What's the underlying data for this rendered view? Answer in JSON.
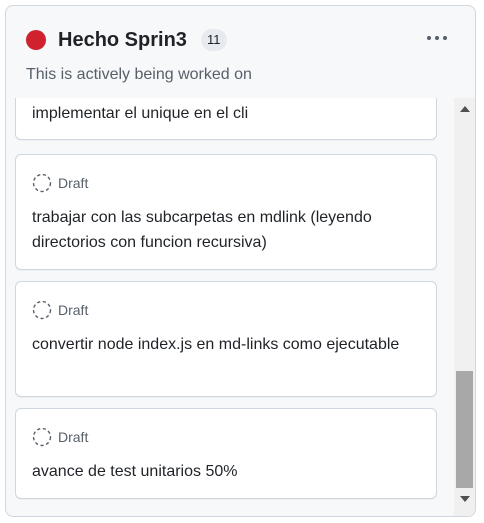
{
  "column": {
    "title": "Hecho Sprin3",
    "count": "11",
    "description": "This is actively being worked on",
    "status_color": "#cf222e",
    "more_icon": "kebab-horizontal-icon"
  },
  "cards": [
    {
      "title": "implementar el unique en el cli",
      "status": ""
    },
    {
      "title": "trabajar con las subcarpetas en mdlink (leyendo directorios con funcion recursiva)",
      "status": "Draft"
    },
    {
      "title": "convertir node index.js en md-links como ejecutable",
      "status": "Draft"
    },
    {
      "title": "avance de test unitarios 50%",
      "status": "Draft"
    }
  ],
  "icons": {
    "draft": "draft-circle-icon",
    "scroll_up": "scroll-up-arrow-icon",
    "scroll_down": "scroll-down-arrow-icon"
  }
}
